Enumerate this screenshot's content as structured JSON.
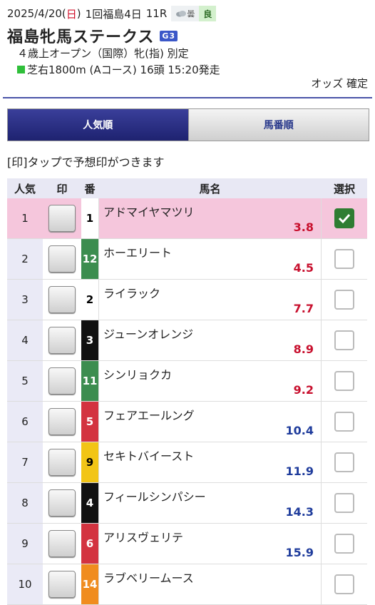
{
  "race": {
    "date": "2025/4/20",
    "day_open": "(",
    "day": "日",
    "day_close": ")",
    "meeting": "1回福島4日",
    "race_no": "11R",
    "weather": "曇",
    "going": "良",
    "name": "福島牝馬ステークス",
    "grade": "G3",
    "conditions": "４歳上オープン（国際）牝(指) 別定",
    "course": "芝右1800m (Aコース) 16頭 15:20発走",
    "odds_status": "オッズ 確定"
  },
  "tabs": {
    "popularity": "人気順",
    "horse_number": "馬番順"
  },
  "hint": "[印]タップで予想印がつきます",
  "columns": {
    "popularity": "人気",
    "mark": "印",
    "number": "番",
    "name": "馬名",
    "select": "選択"
  },
  "horses": [
    {
      "pop": "1",
      "num": "1",
      "name": "アドマイヤマツリ",
      "odds": "3.8",
      "selected": true,
      "num_bg": "#ffffff",
      "num_fg": "#000000",
      "odds_color": "#c8102e"
    },
    {
      "pop": "2",
      "num": "12",
      "name": "ホーエリート",
      "odds": "4.5",
      "selected": false,
      "num_bg": "#3c8d4f",
      "num_fg": "#ffffff",
      "odds_color": "#c8102e"
    },
    {
      "pop": "3",
      "num": "2",
      "name": "ライラック",
      "odds": "7.7",
      "selected": false,
      "num_bg": "#ffffff",
      "num_fg": "#000000",
      "odds_color": "#c8102e"
    },
    {
      "pop": "4",
      "num": "3",
      "name": "ジューンオレンジ",
      "odds": "8.9",
      "selected": false,
      "num_bg": "#111111",
      "num_fg": "#ffffff",
      "odds_color": "#c8102e"
    },
    {
      "pop": "5",
      "num": "11",
      "name": "シンリョクカ",
      "odds": "9.2",
      "selected": false,
      "num_bg": "#3c8d4f",
      "num_fg": "#ffffff",
      "odds_color": "#c8102e"
    },
    {
      "pop": "6",
      "num": "5",
      "name": "フェアエールング",
      "odds": "10.4",
      "selected": false,
      "num_bg": "#d33340",
      "num_fg": "#ffffff",
      "odds_color": "#1f3c9c"
    },
    {
      "pop": "7",
      "num": "9",
      "name": "セキトバイースト",
      "odds": "11.9",
      "selected": false,
      "num_bg": "#f2c516",
      "num_fg": "#000000",
      "odds_color": "#1f3c9c"
    },
    {
      "pop": "8",
      "num": "4",
      "name": "フィールシンパシー",
      "odds": "14.3",
      "selected": false,
      "num_bg": "#111111",
      "num_fg": "#ffffff",
      "odds_color": "#1f3c9c"
    },
    {
      "pop": "9",
      "num": "6",
      "name": "アリスヴェリテ",
      "odds": "15.9",
      "selected": false,
      "num_bg": "#d33340",
      "num_fg": "#ffffff",
      "odds_color": "#1f3c9c"
    },
    {
      "pop": "10",
      "num": "14",
      "name": "ラブベリームース",
      "odds": "",
      "selected": false,
      "num_bg": "#f08c1e",
      "num_fg": "#ffffff",
      "odds_color": "#1f3c9c"
    }
  ],
  "icons": {
    "weather": "cloud-icon",
    "checkbox_checked": "check-icon"
  },
  "colors": {
    "accent": "#1e2270",
    "selected_row": "#f5c6dc",
    "odds_low": "#c8102e",
    "odds_high": "#1f3c9c"
  }
}
